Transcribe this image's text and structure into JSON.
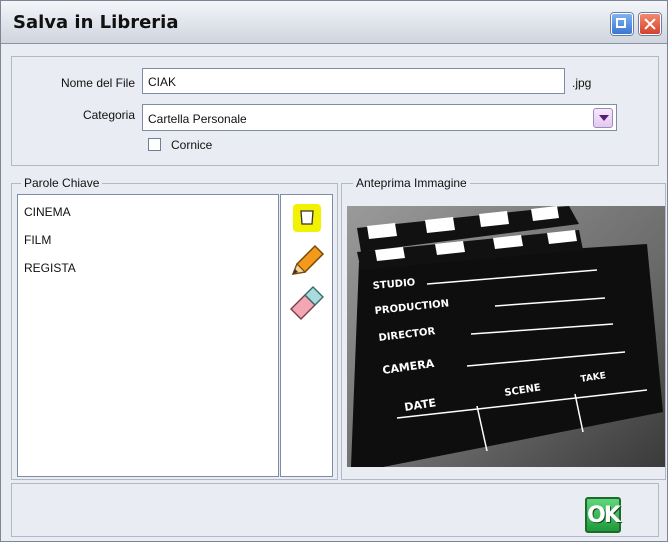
{
  "window": {
    "title": "Salva in Libreria"
  },
  "form": {
    "filename_label": "Nome del File",
    "filename_value": "CIAK",
    "extension": ".jpg",
    "category_label": "Categoria",
    "category_value": "Cartella Personale",
    "frame_label": "Cornice",
    "frame_checked": false
  },
  "keywords": {
    "legend": "Parole Chiave",
    "items": [
      "CINEMA",
      "FILM",
      "REGISTA"
    ],
    "tools": [
      "new-note-icon",
      "pencil-icon",
      "eraser-icon"
    ]
  },
  "preview": {
    "legend": "Anteprima Immagine",
    "labels": [
      "STUDIO",
      "PRODUCTION",
      "DIRECTOR",
      "CAMERA",
      "DATE",
      "SCENE",
      "TAKE"
    ]
  },
  "footer": {
    "ok_label": "OK"
  },
  "colors": {
    "ok_green": "#1f9a3a",
    "title_bar": "#dfe3ea"
  }
}
